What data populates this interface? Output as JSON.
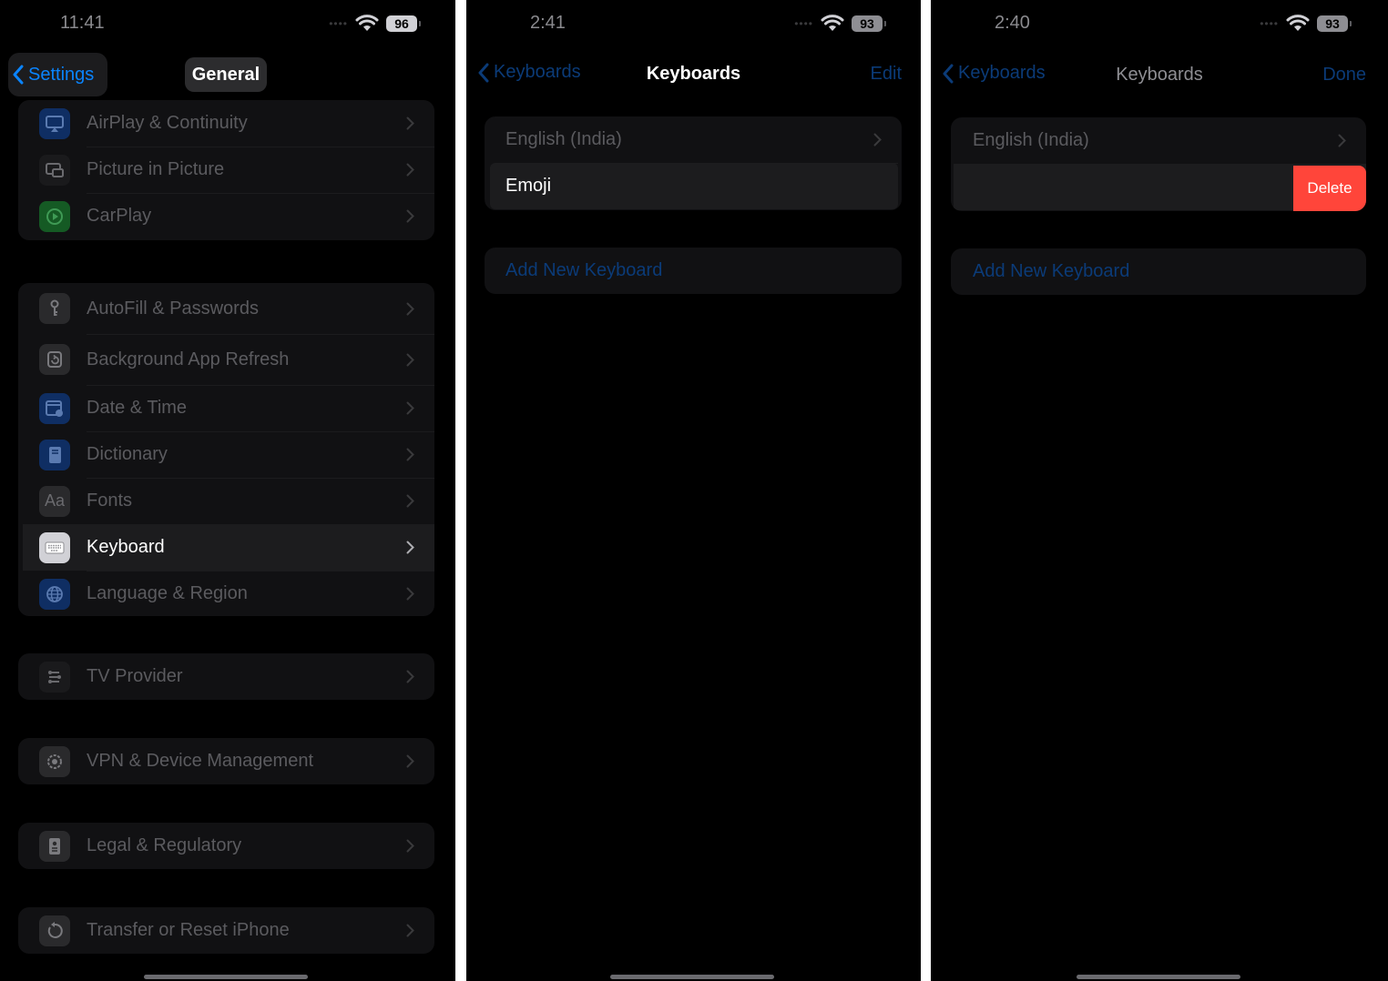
{
  "screens": [
    {
      "status": {
        "time": "11:41",
        "battery": "96"
      },
      "nav": {
        "back_label": "Settings",
        "title": "General"
      },
      "groups": [
        {
          "items": [
            {
              "label": "AirPlay & Continuity",
              "icon": "airplay-icon"
            },
            {
              "label": "Picture in Picture",
              "icon": "picture-in-picture-icon"
            },
            {
              "label": "CarPlay",
              "icon": "carplay-icon"
            }
          ]
        },
        {
          "items": [
            {
              "label": "AutoFill & Passwords",
              "icon": "key-icon"
            },
            {
              "label": "Background App Refresh",
              "icon": "refresh-icon"
            },
            {
              "label": "Date & Time",
              "icon": "calendar-clock-icon"
            },
            {
              "label": "Dictionary",
              "icon": "book-icon"
            },
            {
              "label": "Fonts",
              "icon": "fonts-icon",
              "icon_text": "Aa"
            },
            {
              "label": "Keyboard",
              "icon": "keyboard-icon",
              "highlighted": true
            },
            {
              "label": "Language & Region",
              "icon": "globe-icon"
            }
          ]
        },
        {
          "items": [
            {
              "label": "TV Provider",
              "icon": "tv-provider-icon"
            }
          ]
        },
        {
          "items": [
            {
              "label": "VPN & Device Management",
              "icon": "gear-icon"
            }
          ]
        },
        {
          "items": [
            {
              "label": "Legal & Regulatory",
              "icon": "document-icon"
            }
          ]
        },
        {
          "items": [
            {
              "label": "Transfer or Reset iPhone",
              "icon": "reset-icon"
            }
          ]
        }
      ]
    },
    {
      "status": {
        "time": "2:41",
        "battery": "93"
      },
      "nav": {
        "back_label": "Keyboards",
        "title": "Keyboards",
        "action": "Edit"
      },
      "keyboards": [
        {
          "label": "English (India)"
        },
        {
          "label": "Emoji"
        }
      ],
      "add_keyboard": "Add New Keyboard"
    },
    {
      "status": {
        "time": "2:40",
        "battery": "93"
      },
      "nav": {
        "back_label": "Keyboards",
        "title": "Keyboards",
        "action": "Done"
      },
      "keyboards": [
        {
          "label": "English (India)"
        }
      ],
      "delete_label": "Delete",
      "add_keyboard": "Add New Keyboard"
    }
  ],
  "colors": {
    "accent_blue": "#0a84ff",
    "delete_red": "#ff453a",
    "highlight_row": "#1c1c1e",
    "dim_text": "#5b5b5f"
  }
}
